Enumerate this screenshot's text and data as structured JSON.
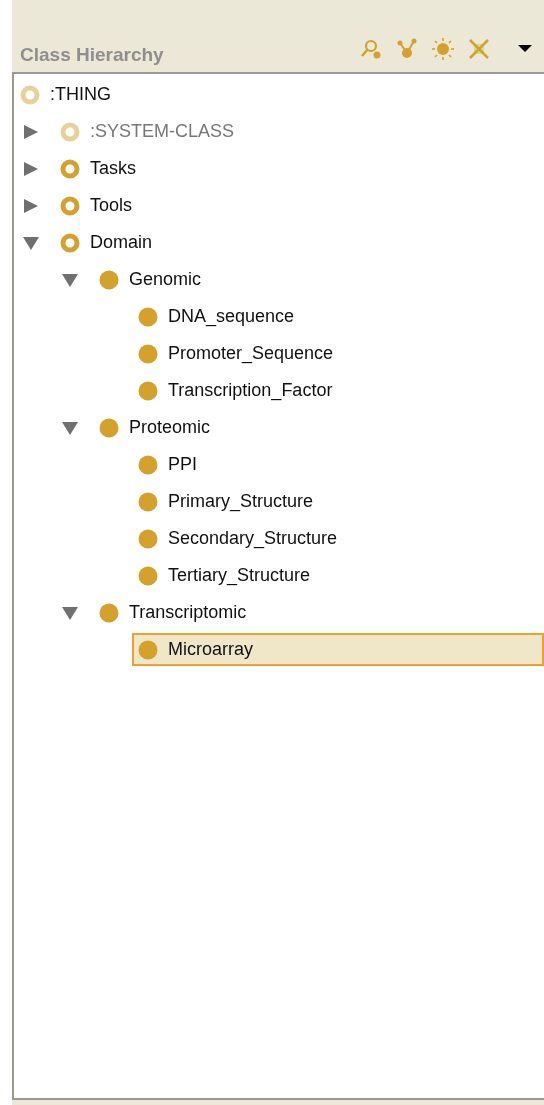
{
  "panel": {
    "title": "Class Hierarchy"
  },
  "tree": [
    {
      "label": ":THING",
      "kind": "system",
      "selected": false,
      "children": [
        {
          "label": ":SYSTEM-CLASS",
          "kind": "system",
          "expanded": false,
          "selected": false
        },
        {
          "label": "Tasks",
          "kind": "abstract",
          "expanded": false,
          "selected": false
        },
        {
          "label": "Tools",
          "kind": "abstract",
          "expanded": false,
          "selected": false
        },
        {
          "label": "Domain",
          "kind": "abstract",
          "expanded": true,
          "selected": false,
          "children": [
            {
              "label": "Genomic",
              "kind": "concrete",
              "expanded": true,
              "selected": false,
              "children": [
                {
                  "label": "DNA_sequence",
                  "kind": "concrete",
                  "selected": false
                },
                {
                  "label": "Promoter_Sequence",
                  "kind": "concrete",
                  "selected": false
                },
                {
                  "label": "Transcription_Factor",
                  "kind": "concrete",
                  "selected": false
                }
              ]
            },
            {
              "label": "Proteomic",
              "kind": "concrete",
              "expanded": true,
              "selected": false,
              "children": [
                {
                  "label": "PPI",
                  "kind": "concrete",
                  "selected": false
                },
                {
                  "label": "Primary_Structure",
                  "kind": "concrete",
                  "selected": false
                },
                {
                  "label": "Secondary_Structure",
                  "kind": "concrete",
                  "selected": false
                },
                {
                  "label": "Tertiary_Structure",
                  "kind": "concrete",
                  "selected": false
                }
              ]
            },
            {
              "label": "Transcriptomic",
              "kind": "concrete",
              "expanded": true,
              "selected": false,
              "children": [
                {
                  "label": "Microarray",
                  "kind": "concrete",
                  "selected": true
                }
              ]
            }
          ]
        }
      ]
    }
  ]
}
